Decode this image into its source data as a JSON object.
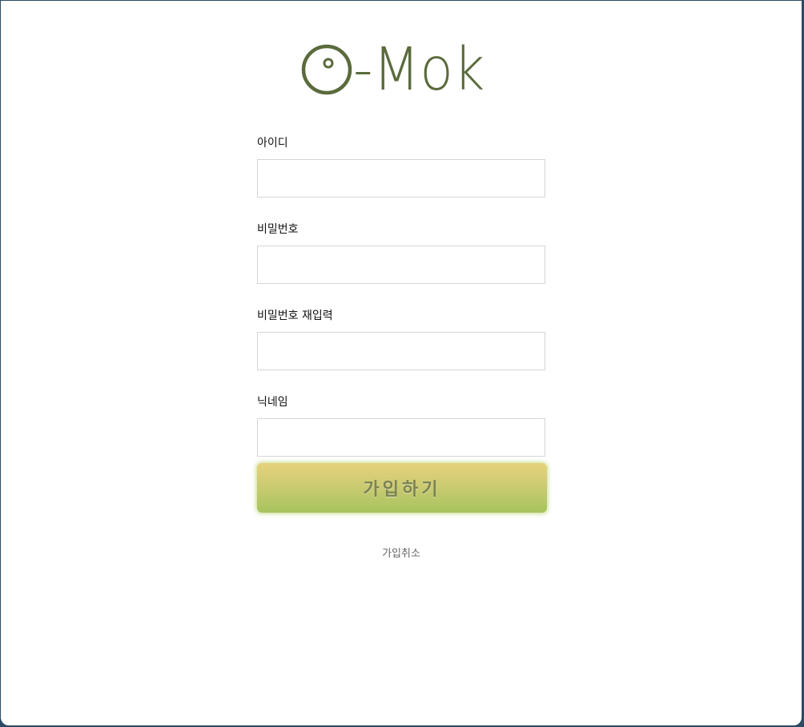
{
  "brand": {
    "logo_text": "-Mok",
    "color": "#5a6b3c"
  },
  "form": {
    "fields": [
      {
        "label": "아이디",
        "value": ""
      },
      {
        "label": "비밀번호",
        "value": ""
      },
      {
        "label": "비밀번호 재입력",
        "value": ""
      },
      {
        "label": "닉네임",
        "value": ""
      }
    ],
    "submit_label": "가입하기",
    "cancel_label": "가입취소"
  },
  "colors": {
    "button_top": "#e8d27c",
    "button_bottom": "#a7c35e",
    "input_border": "#d6d6d6"
  }
}
